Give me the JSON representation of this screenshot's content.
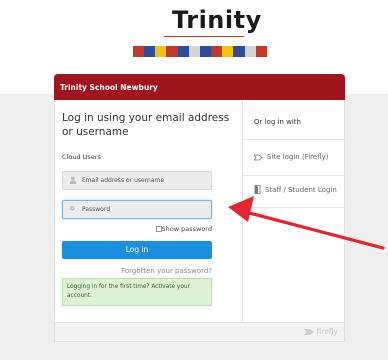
{
  "logo": {
    "name": "Trinity",
    "bar_colors": [
      "#c0392b",
      "#2b4d9b",
      "#f1c40f",
      "#c0392b",
      "#2b4d9b",
      "#d4d4d4",
      "#2b4d9b",
      "#c0392b",
      "#f1c40f",
      "#2b4d9b",
      "#d4d4d4",
      "#c0392b"
    ]
  },
  "card": {
    "header_title": "Trinity School Newbury",
    "title": "Log in using your email address or username",
    "group_label": "Cloud Users",
    "email_placeholder": "Email address or username",
    "password_placeholder": "Password",
    "show_password_label": "Show password",
    "login_button": "Log in",
    "forgot_link": "Forgotten your password?",
    "first_time_notice": "Logging in for the first time? Activate your account."
  },
  "alt_login": {
    "heading": "Or log in with",
    "options": [
      {
        "label": "Site login (Firefly)",
        "icon": "firefly-icon"
      },
      {
        "label": "Staff / Student Login",
        "icon": "door-icon"
      }
    ]
  },
  "footer": {
    "brand": "firefly"
  },
  "colors": {
    "header": "#a0141e",
    "button": "#1a8fdd",
    "arrow": "#e2262d",
    "notice_bg": "#ddf2d5"
  }
}
